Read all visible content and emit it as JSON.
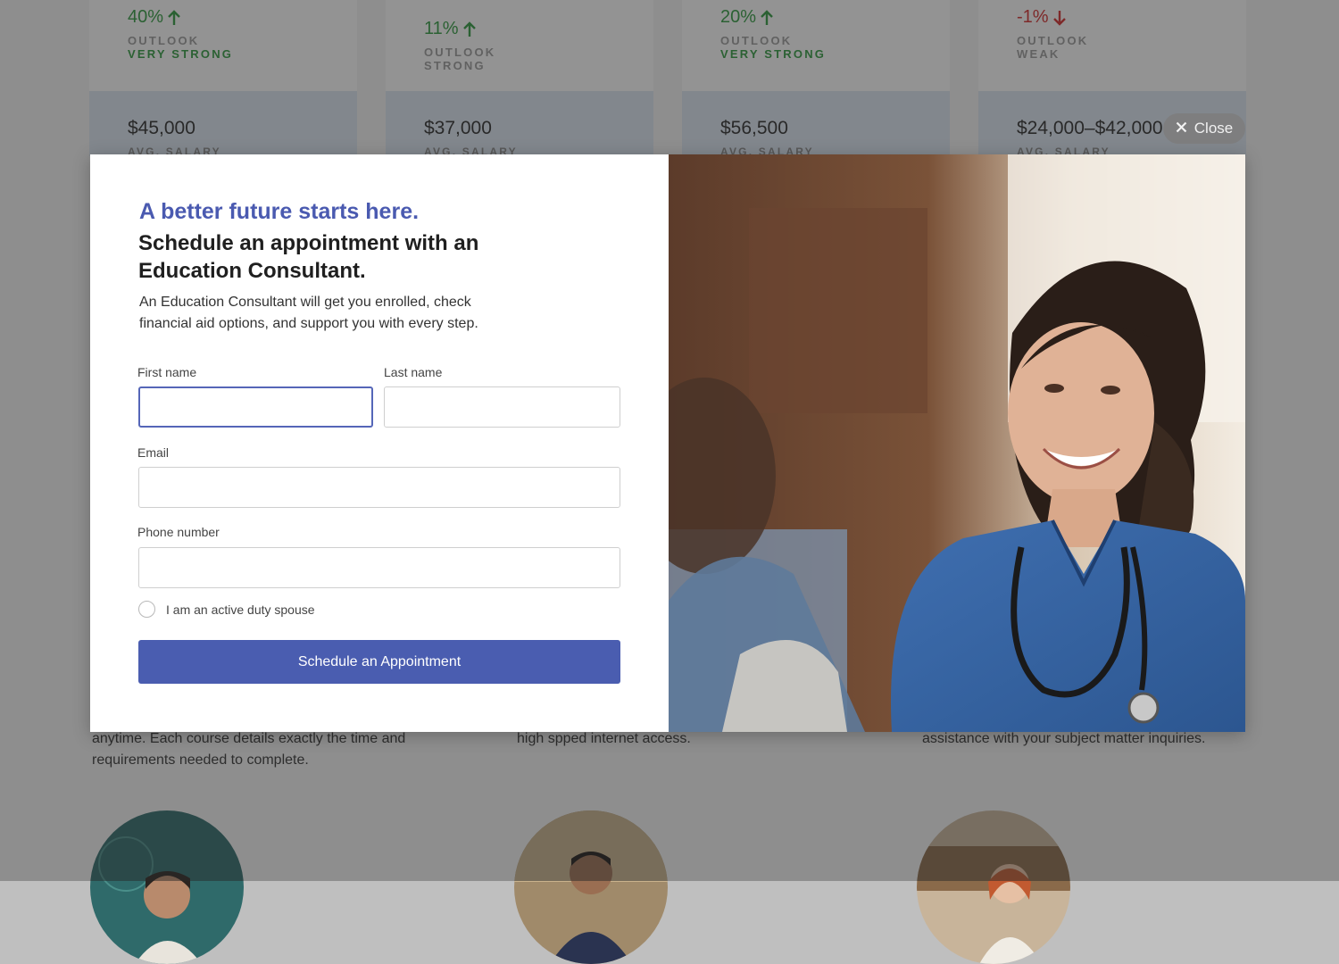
{
  "cards": [
    {
      "growth": "40%",
      "direction": "up",
      "outlook_label": "OUTLOOK",
      "outlook_value": "VERY STRONG",
      "salary": "$45,000",
      "salary_label": "AVG. SALARY"
    },
    {
      "growth": "11%",
      "direction": "up",
      "outlook_label": "OUTLOOK",
      "outlook_value": "STRONG",
      "salary": "$37,000",
      "salary_label": "AVG. SALARY"
    },
    {
      "growth": "20%",
      "direction": "up",
      "outlook_label": "OUTLOOK",
      "outlook_value": "VERY STRONG",
      "salary": "$56,500",
      "salary_label": "AVG. SALARY"
    },
    {
      "growth": "-1%",
      "direction": "down",
      "outlook_label": "OUTLOOK",
      "outlook_value": "WEAK",
      "salary": "$24,000–$42,000",
      "salary_label": "AVG. SALARY"
    }
  ],
  "features": [
    {
      "text": "anytime. Each course details exactly the time and requirements needed to complete."
    },
    {
      "text": "high spped internet access."
    },
    {
      "text": "assistance with your subject matter inquiries."
    }
  ],
  "close_label": "Close",
  "modal": {
    "tagline": "A better future starts here.",
    "headline": "Schedule an appointment with an Education Consultant.",
    "description": "An Education Consultant will get you enrolled, check financial aid options, and support you with every step.",
    "form": {
      "first_name_label": "First name",
      "first_name_value": "",
      "last_name_label": "Last name",
      "last_name_value": "",
      "email_label": "Email",
      "email_value": "",
      "phone_label": "Phone number",
      "phone_value": "",
      "spouse_label": "I am an active duty spouse",
      "submit_label": "Schedule an Appointment"
    }
  },
  "colors": {
    "accent": "#4a5db0",
    "positive": "#2e9a3e",
    "negative": "#d42b2b"
  },
  "icons": [
    "arrow-up-icon",
    "arrow-down-icon",
    "close-icon"
  ]
}
